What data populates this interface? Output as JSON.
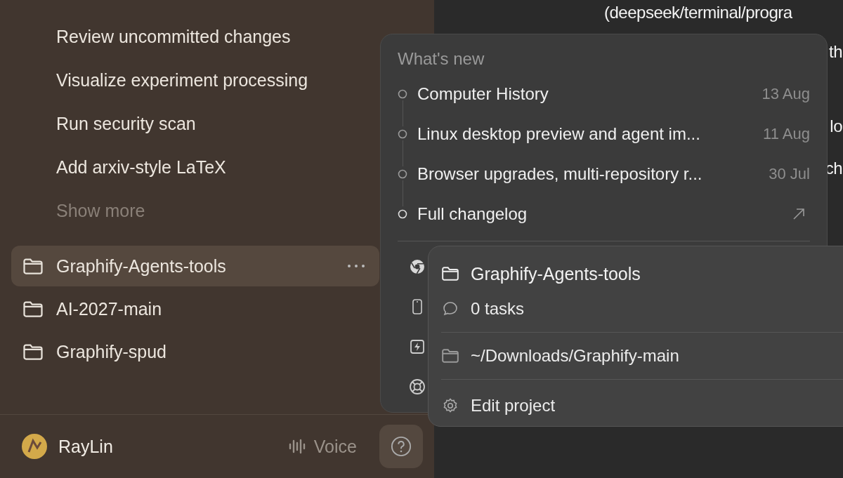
{
  "sidebar": {
    "tasks": [
      {
        "label": "Review uncommitted changes",
        "kind": "task"
      },
      {
        "label": "Visualize experiment processing",
        "kind": "task"
      },
      {
        "label": "Run security scan",
        "kind": "task"
      },
      {
        "label": "Add arxiv-style LaTeX",
        "kind": "task"
      },
      {
        "label": "Show more",
        "kind": "more"
      }
    ],
    "projects": [
      {
        "name": "Graphify-Agents-tools",
        "selected": true
      },
      {
        "name": "AI-2027-main",
        "selected": false
      },
      {
        "name": "Graphify-spud",
        "selected": false
      }
    ],
    "user": {
      "name": "RayLin"
    },
    "voice_button": "Voice"
  },
  "chat": {
    "lines": [
      "(deepseek/terminal/progra",
      "th",
      "lo",
      "ch"
    ]
  },
  "whats_new": {
    "title": "What's new",
    "items": [
      {
        "title": "Computer History",
        "date": "13 Aug",
        "kind": "entry"
      },
      {
        "title": "Linux desktop preview and agent im...",
        "date": "11 Aug",
        "kind": "entry"
      },
      {
        "title": "Browser upgrades, multi-repository r...",
        "date": "30 Jul",
        "kind": "entry"
      },
      {
        "title": "Full changelog",
        "kind": "link"
      }
    ]
  },
  "project_menu": {
    "title": "Graphify-Agents-tools",
    "tasks": "0 tasks",
    "path": "~/Downloads/Graphify-main",
    "action": "Edit project"
  }
}
